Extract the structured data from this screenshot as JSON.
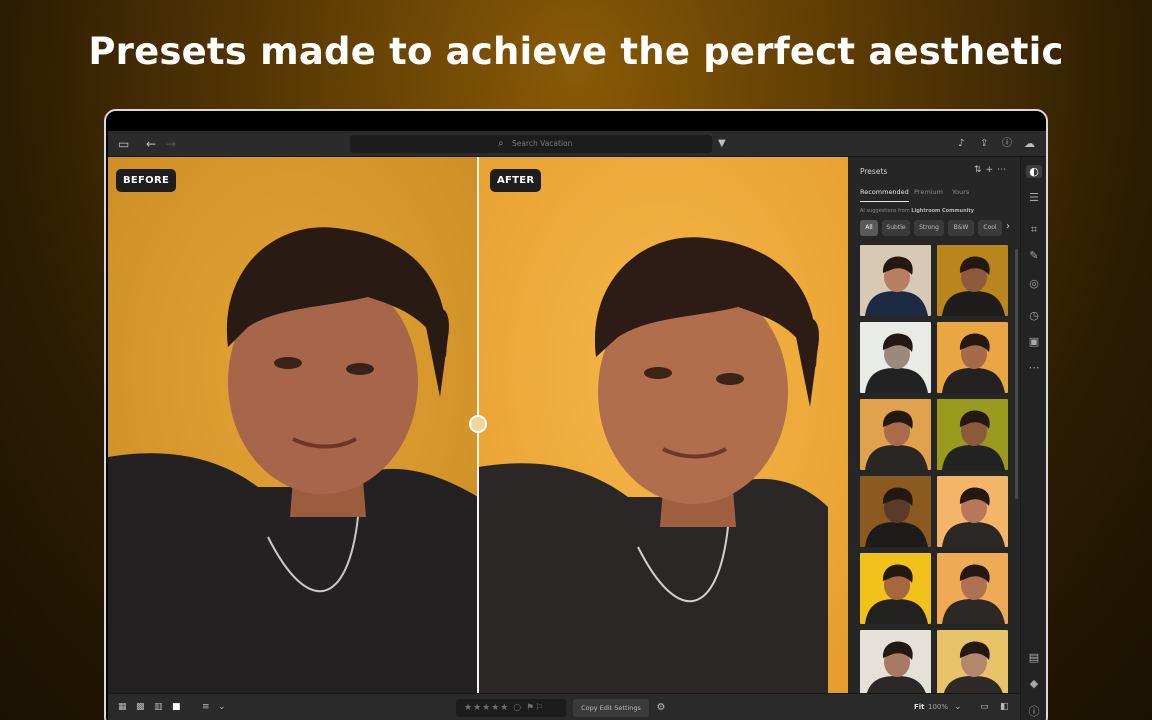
{
  "headline": "Presets made to achieve the perfect aesthetic",
  "topbar": {
    "search_placeholder": "Search Vacation",
    "icons": [
      "sidebar-toggle-icon",
      "back-arrow-icon",
      "forward-arrow-icon",
      "search-icon",
      "filter-icon",
      "bell-icon",
      "share-icon",
      "help-icon",
      "cloud-icon"
    ]
  },
  "compare": {
    "before_label": "BEFORE",
    "after_label": "AFTER",
    "split_position": 0.5
  },
  "presets_panel": {
    "title": "Presets",
    "tabs": [
      "Recommended",
      "Premium",
      "Yours"
    ],
    "active_tab": "Recommended",
    "suggestion_prefix": "AI suggestions from",
    "suggestion_source": "Lightroom Community",
    "chips": [
      "All",
      "Subtle",
      "Strong",
      "B&W",
      "Cool"
    ],
    "active_chip": "All",
    "thumbnail_count": 12
  },
  "bottombar": {
    "copy_label": "Copy Edit Settings",
    "fit_label": "Fit",
    "zoom_label": "100%"
  },
  "colors": {
    "before_backdrop": "#dd9a2e",
    "after_backdrop": "#f0ad3c",
    "app_background": "#1f1f1f"
  }
}
